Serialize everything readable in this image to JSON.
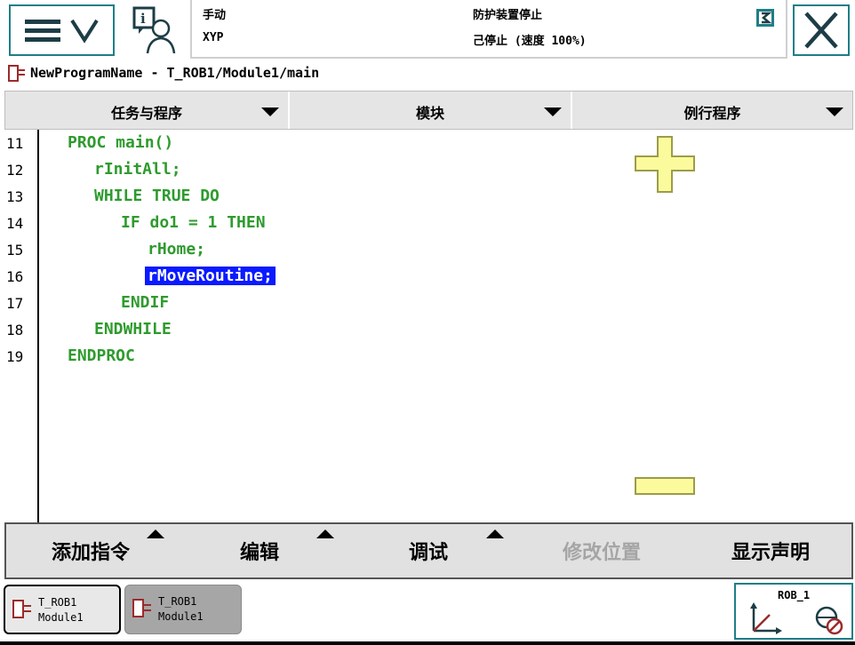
{
  "header": {
    "mode": "手动",
    "controller": "XYP",
    "safety_state": "防护装置停止",
    "run_state": "己停止 (速度 100%)"
  },
  "breadcrumb": "NewProgramName - T_ROB1/Module1/main",
  "selectors": [
    {
      "label": "任务与程序"
    },
    {
      "label": "模块"
    },
    {
      "label": "例行程序"
    }
  ],
  "code": {
    "line_numbers": [
      "11",
      "12",
      "13",
      "14",
      "15",
      "16",
      "17",
      "18",
      "19"
    ],
    "lines": [
      "PROC main()",
      "rInitAll;",
      "WHILE TRUE DO",
      "IF do1 = 1 THEN",
      "rHome;",
      "rMoveRoutine;",
      "ENDIF",
      "ENDWHILE",
      "ENDPROC"
    ],
    "indent_levels": [
      0,
      1,
      1,
      2,
      3,
      3,
      2,
      1,
      0
    ],
    "selected_index": 5
  },
  "commands": [
    {
      "label": "添加指令",
      "menu": true,
      "enabled": true
    },
    {
      "label": "编辑",
      "menu": true,
      "enabled": true
    },
    {
      "label": "调试",
      "menu": true,
      "enabled": true
    },
    {
      "label": "修改位置",
      "menu": false,
      "enabled": false
    },
    {
      "label": "显示声明",
      "menu": false,
      "enabled": true
    }
  ],
  "tasks": [
    {
      "line1": "T_ROB1",
      "line2": "Module1",
      "active": true
    },
    {
      "line1": "T_ROB1",
      "line2": "Module1",
      "active": false
    }
  ],
  "robot_unit": "ROB_1",
  "colors": {
    "accent": "#1f7e86",
    "code_green": "#2e9b2e",
    "selection_blue": "#0a1aff",
    "zoom_yellow": "#fbfb9e"
  }
}
